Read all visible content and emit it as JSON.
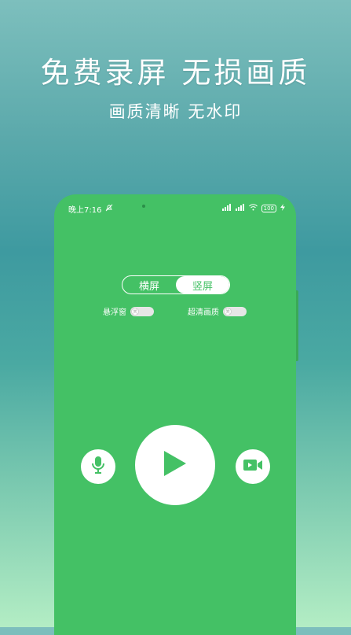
{
  "promo": {
    "headline": "免费录屏 无损画质",
    "subline": "画质清晰 无水印"
  },
  "statusbar": {
    "time": "晚上7:16",
    "battery": "100"
  },
  "orientation": {
    "options": [
      "横屏",
      "竖屏"
    ],
    "selected": "竖屏"
  },
  "toggles": {
    "floating_window": {
      "label": "悬浮窗",
      "state_text": "关"
    },
    "hd_quality": {
      "label": "超清画质",
      "state_text": "关"
    }
  },
  "icons": {
    "mic": "microphone-icon",
    "play": "play-icon",
    "video": "video-camera-icon"
  },
  "colors": {
    "accent": "#44c165",
    "white": "#ffffff"
  }
}
